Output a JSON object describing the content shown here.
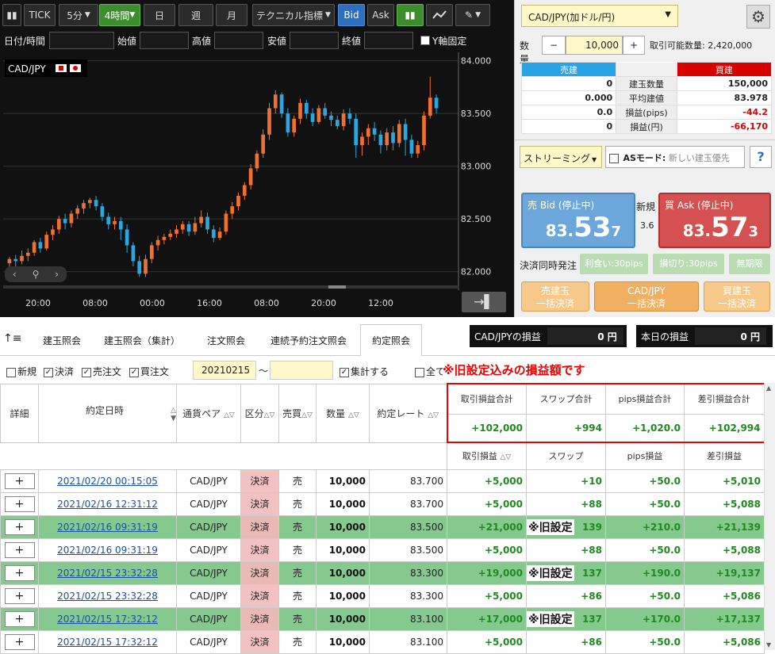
{
  "chart_toolbar": {
    "tick": "TICK",
    "interval": "5分",
    "active_interval": "4時間",
    "day": "日",
    "week": "週",
    "month": "月",
    "technical": "テクニカル指標",
    "bid": "Bid",
    "ask": "Ask"
  },
  "chart_inputs": {
    "datetime": "日付/時間",
    "open": "始値",
    "high": "高値",
    "low": "安値",
    "close": "終値",
    "yfix": "Y軸固定"
  },
  "chart_data": {
    "type": "candlestick",
    "title": "CAD/JPY",
    "ylim": [
      81.9,
      84.05
    ],
    "yticks": [
      "84.000",
      "83.500",
      "83.000",
      "82.500",
      "82.000"
    ],
    "xticks": [
      "20:00",
      "08:00",
      "00:00",
      "16:00",
      "08:00",
      "20:00",
      "12:00"
    ],
    "up_color": "#f07030",
    "down_color": "#29a8e0",
    "candles": [
      [
        82.08,
        82.12,
        82.02,
        82.14
      ],
      [
        82.12,
        82.1,
        82.05,
        82.16
      ],
      [
        82.1,
        82.15,
        82.07,
        82.2
      ],
      [
        82.15,
        82.18,
        82.1,
        82.22
      ],
      [
        82.18,
        82.28,
        82.15,
        82.3
      ],
      [
        82.28,
        82.22,
        82.18,
        82.32
      ],
      [
        82.22,
        82.35,
        82.2,
        82.38
      ],
      [
        82.35,
        82.4,
        82.3,
        82.44
      ],
      [
        82.4,
        82.5,
        82.36,
        82.53
      ],
      [
        82.5,
        82.46,
        82.4,
        82.55
      ],
      [
        82.46,
        82.55,
        82.42,
        82.58
      ],
      [
        82.55,
        82.6,
        82.5,
        82.63
      ],
      [
        82.6,
        82.65,
        82.55,
        82.68
      ],
      [
        82.65,
        82.68,
        82.6,
        82.7
      ],
      [
        82.68,
        82.62,
        82.58,
        82.72
      ],
      [
        82.62,
        82.52,
        82.48,
        82.65
      ],
      [
        82.52,
        82.45,
        82.4,
        82.56
      ],
      [
        82.45,
        82.48,
        82.4,
        82.52
      ],
      [
        82.48,
        82.4,
        82.3,
        82.52
      ],
      [
        82.4,
        82.25,
        82.18,
        82.45
      ],
      [
        82.25,
        82.1,
        82.05,
        82.28
      ],
      [
        82.1,
        81.98,
        81.95,
        82.15
      ],
      [
        81.98,
        82.12,
        81.95,
        82.16
      ],
      [
        82.12,
        82.25,
        82.08,
        82.28
      ],
      [
        82.25,
        82.3,
        82.2,
        82.34
      ],
      [
        82.3,
        82.33,
        82.26,
        82.36
      ],
      [
        82.33,
        82.36,
        82.3,
        82.4
      ],
      [
        82.36,
        82.4,
        82.32,
        82.44
      ],
      [
        82.4,
        82.45,
        82.36,
        82.48
      ],
      [
        82.45,
        82.38,
        82.34,
        82.48
      ],
      [
        82.38,
        82.46,
        82.35,
        82.52
      ],
      [
        82.46,
        82.52,
        82.42,
        82.58
      ],
      [
        82.52,
        82.4,
        82.36,
        82.56
      ],
      [
        82.4,
        82.32,
        82.28,
        82.44
      ],
      [
        82.32,
        82.38,
        82.3,
        82.42
      ],
      [
        82.38,
        82.55,
        82.35,
        82.58
      ],
      [
        82.55,
        82.62,
        82.5,
        82.66
      ],
      [
        82.62,
        82.72,
        82.58,
        82.75
      ],
      [
        82.72,
        82.82,
        82.68,
        82.85
      ],
      [
        82.82,
        82.98,
        82.78,
        83.02
      ],
      [
        82.98,
        83.12,
        82.95,
        83.15
      ],
      [
        83.12,
        83.3,
        83.08,
        83.35
      ],
      [
        83.3,
        83.55,
        83.25,
        83.6
      ],
      [
        83.55,
        83.68,
        83.5,
        83.72
      ],
      [
        83.68,
        83.5,
        83.46,
        83.7
      ],
      [
        83.5,
        83.32,
        83.28,
        83.55
      ],
      [
        83.32,
        83.45,
        83.28,
        83.48
      ],
      [
        83.45,
        83.6,
        83.4,
        83.64
      ],
      [
        83.6,
        83.5,
        83.45,
        83.63
      ],
      [
        83.5,
        83.42,
        83.38,
        83.55
      ],
      [
        83.42,
        83.55,
        83.4,
        83.58
      ],
      [
        83.55,
        83.48,
        83.45,
        83.6
      ],
      [
        83.48,
        83.44,
        83.38,
        83.52
      ],
      [
        83.44,
        83.38,
        83.35,
        83.48
      ],
      [
        83.38,
        83.5,
        83.34,
        83.54
      ],
      [
        83.5,
        83.45,
        83.4,
        83.55
      ],
      [
        83.45,
        83.2,
        83.08,
        83.5
      ],
      [
        83.2,
        83.28,
        83.1,
        83.32
      ],
      [
        83.28,
        83.36,
        83.2,
        83.4
      ],
      [
        83.36,
        83.3,
        83.24,
        83.42
      ],
      [
        83.3,
        83.2,
        83.12,
        83.34
      ],
      [
        83.2,
        83.32,
        83.15,
        83.36
      ],
      [
        83.32,
        83.22,
        83.15,
        83.38
      ],
      [
        83.22,
        83.4,
        83.18,
        83.44
      ],
      [
        83.4,
        83.25,
        83.1,
        83.45
      ],
      [
        83.25,
        83.12,
        83.08,
        83.3
      ],
      [
        83.12,
        83.2,
        83.08,
        83.24
      ],
      [
        83.2,
        83.48,
        83.15,
        83.52
      ],
      [
        83.48,
        83.65,
        83.45,
        83.85
      ],
      [
        83.65,
        83.55,
        83.5,
        83.68
      ]
    ]
  },
  "order_panel": {
    "pair": "CAD/JPY(加ドル/円)",
    "qty_label": "数量",
    "qty_minus": "−",
    "qty_value": "10,000",
    "qty_plus": "+",
    "available": "取引可能数量: 2,420,000",
    "sell_head": "売建",
    "buy_head": "買建",
    "rows": [
      {
        "sell": "0",
        "label": "建玉数量",
        "buy": "150,000"
      },
      {
        "sell": "0.000",
        "label": "平均建値",
        "buy": "83.978"
      },
      {
        "sell": "0.0",
        "label": "損益(pips)",
        "buy": "-44.2"
      },
      {
        "sell": "0",
        "label": "損益(円)",
        "buy": "-66,170"
      }
    ],
    "streaming": "ストリーミング",
    "as_mode": "ASモード:",
    "as_placeholder": "新しい建玉優先",
    "help": "?",
    "sell_bid_label": "売 Bid (停止中)",
    "sell_bid_main": "83.",
    "sell_bid_big": "53",
    "sell_bid_small": "7",
    "new_label": "新規",
    "spread": "3.6",
    "buy_ask_label": "買 Ask (停止中)",
    "buy_ask_main": "83.",
    "buy_ask_big": "57",
    "buy_ask_small": "3",
    "settle_label": "決済同時発注",
    "take_profit": "利食い:30pips",
    "stop_loss": "損切り:30pips",
    "indefinite": "無期限",
    "bulk_sell_1": "売建玉",
    "bulk_sell_2": "一括決済",
    "bulk_pair_1": "CAD/JPY",
    "bulk_pair_2": "一括決済",
    "bulk_buy_1": "買建玉",
    "bulk_buy_2": "一括決済"
  },
  "tabs": {
    "t1": "建玉照会",
    "t2": "建玉照会（集計）",
    "t3": "注文照会",
    "t4": "連続予約注文照会",
    "t5": "約定照会"
  },
  "pl": {
    "pair_label": "CAD/JPYの損益",
    "pair_value": "0 円",
    "today_label": "本日の損益",
    "today_value": "0 円"
  },
  "filter": {
    "new": "新規",
    "settle": "決済",
    "sell": "売注文",
    "buy": "買注文",
    "from": "20210215",
    "tilde": "〜",
    "aggregate": "集計する",
    "all": "全て",
    "annotation": "※旧設定込みの損益額です"
  },
  "grid": {
    "h_detail": "詳細",
    "h_date": "約定日時",
    "h_pair": "通貨ペア",
    "h_kubun": "区分",
    "h_side": "売買",
    "h_qty": "数量",
    "h_rate": "約定レート",
    "h_trade_total": "取引損益合計",
    "h_swap_total": "スワップ合計",
    "h_pips_total": "pips損益合計",
    "h_net_total": "差引損益合計",
    "tot_trade": "+102,000",
    "tot_swap": "+994",
    "tot_pips": "+1,020.0",
    "tot_net": "+102,994",
    "h_trade": "取引損益",
    "h_swap": "スワップ",
    "h_pips": "pips損益",
    "h_net": "差引損益",
    "old_mark": "※旧設定",
    "rows": [
      {
        "date": "2021/02/20 00:15:05",
        "pair": "CAD/JPY",
        "kubun": "決済",
        "side": "売",
        "qty": "10,000",
        "rate": "83.700",
        "trade": "+5,000",
        "swap": "+10",
        "pips": "+50.0",
        "net": "+5,010"
      },
      {
        "date": "2021/02/16 12:31:12",
        "pair": "CAD/JPY",
        "kubun": "決済",
        "side": "売",
        "qty": "10,000",
        "rate": "83.700",
        "trade": "+5,000",
        "swap": "+88",
        "pips": "+50.0",
        "net": "+5,088"
      },
      {
        "date": "2021/02/16 09:31:19",
        "pair": "CAD/JPY",
        "kubun": "決済",
        "side": "売",
        "qty": "10,000",
        "rate": "83.500",
        "trade": "+21,000",
        "swap": "139",
        "pips": "+210.0",
        "net": "+21,139"
      },
      {
        "date": "2021/02/16 09:31:19",
        "pair": "CAD/JPY",
        "kubun": "決済",
        "side": "売",
        "qty": "10,000",
        "rate": "83.500",
        "trade": "+5,000",
        "swap": "+88",
        "pips": "+50.0",
        "net": "+5,088"
      },
      {
        "date": "2021/02/15 23:32:28",
        "pair": "CAD/JPY",
        "kubun": "決済",
        "side": "売",
        "qty": "10,000",
        "rate": "83.300",
        "trade": "+19,000",
        "swap": "137",
        "pips": "+190.0",
        "net": "+19,137"
      },
      {
        "date": "2021/02/15 23:32:28",
        "pair": "CAD/JPY",
        "kubun": "決済",
        "side": "売",
        "qty": "10,000",
        "rate": "83.300",
        "trade": "+5,000",
        "swap": "+86",
        "pips": "+50.0",
        "net": "+5,086"
      },
      {
        "date": "2021/02/15 17:32:12",
        "pair": "CAD/JPY",
        "kubun": "決済",
        "side": "売",
        "qty": "10,000",
        "rate": "83.100",
        "trade": "+17,000",
        "swap": "137",
        "pips": "+170.0",
        "net": "+17,137"
      },
      {
        "date": "2021/02/15 17:32:12",
        "pair": "CAD/JPY",
        "kubun": "決済",
        "side": "売",
        "qty": "10,000",
        "rate": "83.100",
        "trade": "+5,000",
        "swap": "+86",
        "pips": "+50.0",
        "net": "+5,086"
      }
    ],
    "plus": "+"
  }
}
